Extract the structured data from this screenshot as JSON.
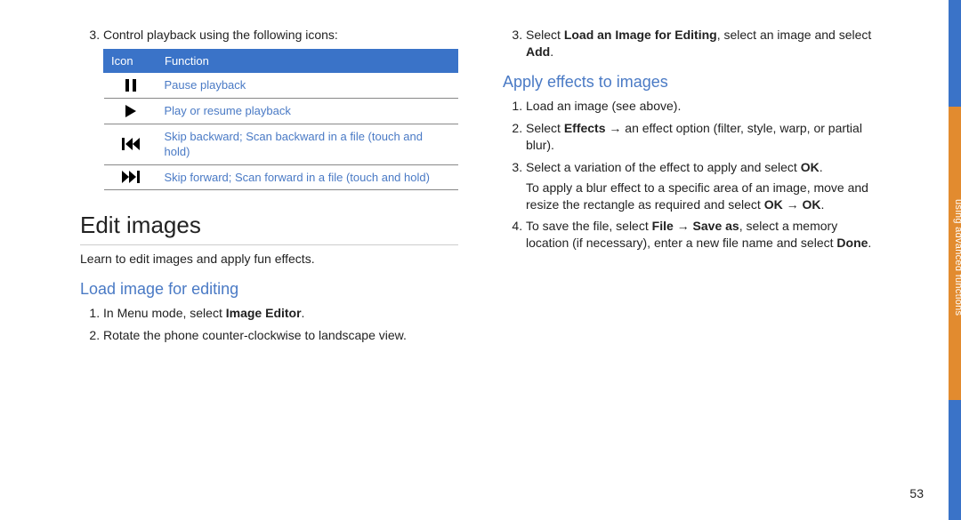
{
  "left": {
    "step3_intro": "Control playback using the following icons:",
    "table": {
      "h_icon": "Icon",
      "h_func": "Function",
      "rows": [
        {
          "icon": "pause",
          "text": "Pause playback"
        },
        {
          "icon": "play",
          "text": "Play or resume playback"
        },
        {
          "icon": "prev",
          "text": "Skip backward; Scan backward in a file (touch and hold)"
        },
        {
          "icon": "next",
          "text": "Skip forward; Scan forward in a file (touch and hold)"
        }
      ]
    },
    "h1": "Edit images",
    "intro": "Learn to edit images and apply fun effects.",
    "h2": "Load image for editing",
    "steps": {
      "s1_pre": "In Menu mode, select ",
      "s1_bold": "Image Editor",
      "s1_post": ".",
      "s2": "Rotate the phone counter-clockwise to landscape view."
    }
  },
  "right": {
    "step3": {
      "pre": "Select ",
      "bold1": "Load an Image for Editing",
      "mid": ", select an image and select ",
      "bold2": "Add",
      "post": "."
    },
    "h2": "Apply effects to images",
    "s1": "Load an image (see above).",
    "s2": {
      "pre": "Select ",
      "bold": "Effects",
      "post": " → an effect option (filter, style, warp, or partial blur)."
    },
    "s3": {
      "pre": "Select a variation of the effect to apply and select ",
      "bold": "OK",
      "post": ".",
      "extra_pre": "To apply a blur effect to a specific area of an image, move and resize the rectangle as required and select ",
      "extra_bold1": "OK",
      "extra_mid": " → ",
      "extra_bold2": "OK",
      "extra_post": "."
    },
    "s4": {
      "pre": "To save the file, select ",
      "bold1": "File",
      "mid1": " → ",
      "bold2": "Save as",
      "mid2": ", select a memory location (if necessary), enter a new file name and select ",
      "bold3": "Done",
      "post": "."
    }
  },
  "sidebar_label": "using advanced functions",
  "page_number": "53"
}
